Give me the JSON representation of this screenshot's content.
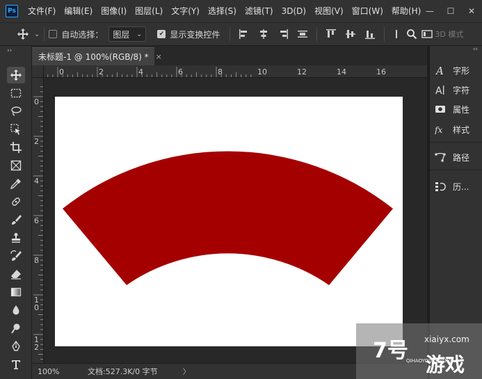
{
  "app": {
    "logo_text": "Ps",
    "menu": [
      "文件(F)",
      "编辑(E)",
      "图像(I)",
      "图层(L)",
      "文字(Y)",
      "选择(S)",
      "滤镜(T)",
      "3D(D)",
      "视图(V)",
      "窗口(W)",
      "帮助(H)"
    ],
    "window_controls": {
      "minimize": "—",
      "maximize": "☐",
      "close": "✕"
    }
  },
  "options_bar": {
    "auto_select_label": "自动选择：",
    "auto_select_checked": false,
    "layer_dropdown_value": "图层",
    "show_transform_label": "显示变换控件",
    "show_transform_checked": true,
    "mode_3d_label": "3D 模式"
  },
  "document": {
    "tab_title": "未标题-1 @ 100%(RGB/8) *",
    "close_glyph": "×",
    "zoom": "100%",
    "doc_info": "文档:527.3K/0 字节",
    "status_arrow": "〉",
    "shape_color": "#a50000",
    "canvas_color": "#ffffff"
  },
  "rulers": {
    "top_labels": [
      "0",
      "2",
      "4",
      "6",
      "8",
      "10",
      "12",
      "14",
      "16"
    ],
    "left_labels": [
      "0",
      "2",
      "4",
      "6",
      "8",
      "10",
      "12"
    ]
  },
  "toolbar": {
    "collapse_glyph": "››",
    "tools": [
      "move-icon",
      "marquee-icon",
      "lasso-icon",
      "object-select-icon",
      "crop-icon",
      "frame-icon",
      "eyedropper-icon",
      "healing-brush-icon",
      "brush-icon",
      "stamp-icon",
      "history-brush-icon",
      "eraser-icon",
      "gradient-icon",
      "blur-icon",
      "dodge-icon",
      "pen-icon",
      "type-icon"
    ]
  },
  "right_panel": {
    "collapse_glyph": "‹‹",
    "items": [
      {
        "icon": "glyph-a-icon",
        "label": "字形"
      },
      {
        "icon": "character-icon",
        "label": "字符"
      },
      {
        "icon": "properties-icon",
        "label": "属性"
      },
      {
        "icon": "fx-icon",
        "label": "样式"
      },
      {
        "icon": "path-icon",
        "label": "路径"
      },
      {
        "icon": "history-icon",
        "label": "历..."
      }
    ]
  },
  "watermark": {
    "domain": "xiaiyx.com",
    "big_text_1": "7号",
    "big_text_2": "游戏",
    "small_text": "QIHAOYOUXIWANG"
  }
}
